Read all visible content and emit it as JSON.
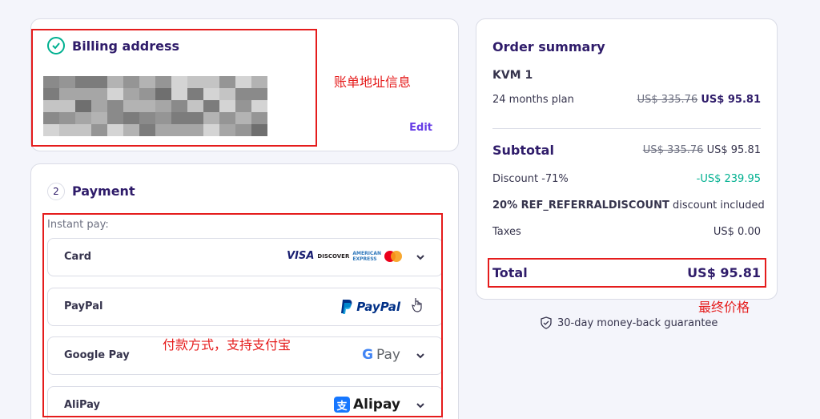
{
  "billing": {
    "title": "Billing address",
    "edit_label": "Edit",
    "annotation": "账单地址信息"
  },
  "payment": {
    "step": "2",
    "title": "Payment",
    "instant_label": "Instant pay:",
    "annotation": "付款方式，支持支付宝",
    "methods": [
      {
        "label": "Card"
      },
      {
        "label": "PayPal"
      },
      {
        "label": "Google Pay"
      },
      {
        "label": "AliPay"
      }
    ],
    "logos": {
      "visa": "VISA",
      "discover": "DISCOVER",
      "amex_line1": "AMERICAN",
      "amex_line2": "EXPRESS",
      "paypal": "PayPal",
      "gpay": "Pay",
      "alipay": "Alipay"
    }
  },
  "summary": {
    "title": "Order summary",
    "product": "KVM 1",
    "plan": "24 months plan",
    "plan_old_price": "US$ 335.76",
    "plan_price": "US$ 95.81",
    "subtotal_label": "Subtotal",
    "subtotal_old": "US$ 335.76",
    "subtotal_price": "US$ 95.81",
    "discount_label": "Discount -71%",
    "discount_value": "-US$ 239.95",
    "referral_code": "20% REF_REFERRALDISCOUNT",
    "referral_suffix": " discount included",
    "taxes_label": "Taxes",
    "taxes_value": "US$ 0.00",
    "total_label": "Total",
    "total_value": "US$ 95.81",
    "annotation": "最终价格"
  },
  "guarantee": "30-day money-back guarantee",
  "colors": {
    "accent": "#673de6",
    "success": "#00b090",
    "annotation": "#e51c1c",
    "text": "#2f1c6a"
  }
}
